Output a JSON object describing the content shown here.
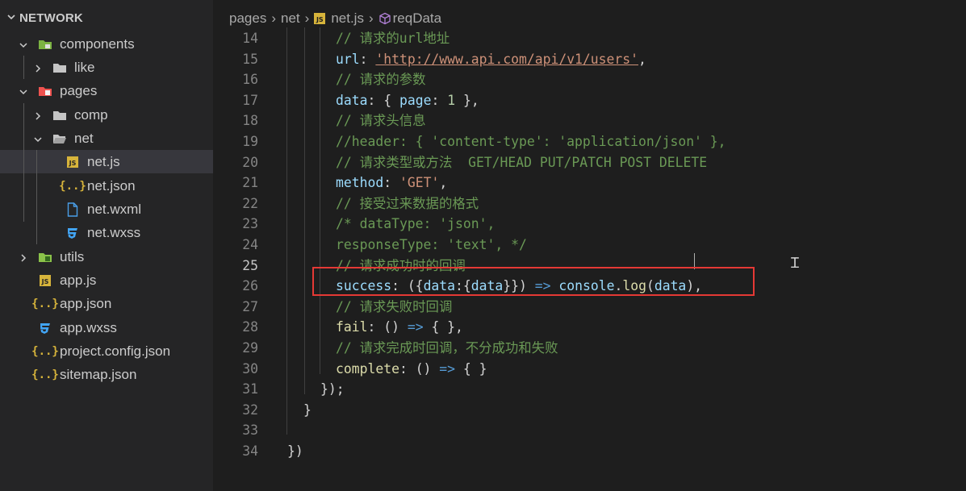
{
  "explorer": {
    "section_title": "NETWORK",
    "items": [
      {
        "label": "components",
        "icon": "folder-components-icon",
        "depth": 1,
        "expanded": true
      },
      {
        "label": "like",
        "icon": "folder-icon",
        "depth": 2,
        "expanded": false
      },
      {
        "label": "pages",
        "icon": "folder-pages-icon",
        "depth": 1,
        "expanded": true
      },
      {
        "label": "comp",
        "icon": "folder-icon",
        "depth": 2,
        "expanded": false
      },
      {
        "label": "net",
        "icon": "folder-open-icon",
        "depth": 2,
        "expanded": true
      },
      {
        "label": "net.js",
        "icon": "js-file-icon",
        "depth": 3,
        "selected": true
      },
      {
        "label": "net.json",
        "icon": "json-file-icon",
        "depth": 3
      },
      {
        "label": "net.wxml",
        "icon": "wxml-file-icon",
        "depth": 3
      },
      {
        "label": "net.wxss",
        "icon": "css-file-icon",
        "depth": 3
      },
      {
        "label": "utils",
        "icon": "folder-utils-icon",
        "depth": 1,
        "expanded": false
      },
      {
        "label": "app.js",
        "icon": "js-file-icon",
        "depth": 1
      },
      {
        "label": "app.json",
        "icon": "json-file-icon",
        "depth": 1
      },
      {
        "label": "app.wxss",
        "icon": "css-file-icon",
        "depth": 1
      },
      {
        "label": "project.config.json",
        "icon": "json-file-icon",
        "depth": 1
      },
      {
        "label": "sitemap.json",
        "icon": "json-file-icon",
        "depth": 1
      }
    ]
  },
  "breadcrumb": {
    "parts": [
      "pages",
      "net",
      "net.js",
      "reqData"
    ]
  },
  "editor": {
    "current_line": "25",
    "lines": [
      {
        "num": "14",
        "tokens": [
          [
            "c",
            "// 请求的url地址"
          ]
        ]
      },
      {
        "num": "15",
        "tokens": [
          [
            "k",
            "url"
          ],
          [
            "p",
            ": "
          ],
          [
            "s",
            "'http://www.api.com/api/v1/users'"
          ],
          [
            "p",
            ","
          ]
        ]
      },
      {
        "num": "16",
        "tokens": [
          [
            "c",
            "// 请求的参数"
          ]
        ]
      },
      {
        "num": "17",
        "tokens": [
          [
            "k",
            "data"
          ],
          [
            "p",
            ": { "
          ],
          [
            "k",
            "page"
          ],
          [
            "p",
            ": "
          ],
          [
            "n",
            "1"
          ],
          [
            "p",
            " },"
          ]
        ]
      },
      {
        "num": "18",
        "tokens": [
          [
            "c",
            "// 请求头信息"
          ]
        ]
      },
      {
        "num": "19",
        "tokens": [
          [
            "c",
            "//header: { 'content-type': 'application/json' },"
          ]
        ]
      },
      {
        "num": "20",
        "tokens": [
          [
            "c",
            "// 请求类型或方法  GET/HEAD PUT/PATCH POST DELETE"
          ]
        ]
      },
      {
        "num": "21",
        "tokens": [
          [
            "k",
            "method"
          ],
          [
            "p",
            ": "
          ],
          [
            "s",
            "'GET'"
          ],
          [
            "p",
            ","
          ]
        ]
      },
      {
        "num": "22",
        "tokens": [
          [
            "c",
            "// 接受过来数据的格式"
          ]
        ]
      },
      {
        "num": "23",
        "tokens": [
          [
            "c",
            "/* dataType: 'json',"
          ]
        ]
      },
      {
        "num": "24",
        "tokens": [
          [
            "c",
            "responseType: 'text', */"
          ]
        ]
      },
      {
        "num": "25",
        "tokens": [
          [
            "c",
            "// 请求成功时的回调"
          ]
        ]
      },
      {
        "num": "26",
        "tokens": [
          [
            "k",
            "success"
          ],
          [
            "p",
            ": ({"
          ],
          [
            "k",
            "data"
          ],
          [
            "p",
            ":{"
          ],
          [
            "k",
            "data"
          ],
          [
            "p",
            "}}) "
          ],
          [
            "o",
            "=>"
          ],
          [
            "p",
            " "
          ],
          [
            "k",
            "console"
          ],
          [
            "p",
            "."
          ],
          [
            "f",
            "log"
          ],
          [
            "p",
            "("
          ],
          [
            "k",
            "data"
          ],
          [
            "p",
            "),"
          ]
        ]
      },
      {
        "num": "27",
        "tokens": [
          [
            "c",
            "// 请求失败时回调"
          ]
        ]
      },
      {
        "num": "28",
        "tokens": [
          [
            "f",
            "fail"
          ],
          [
            "p",
            ": () "
          ],
          [
            "o",
            "=>"
          ],
          [
            "p",
            " { },"
          ]
        ]
      },
      {
        "num": "29",
        "tokens": [
          [
            "c",
            "// 请求完成时回调，不分成功和失败"
          ]
        ]
      },
      {
        "num": "30",
        "tokens": [
          [
            "f",
            "complete"
          ],
          [
            "p",
            ": () "
          ],
          [
            "o",
            "=>"
          ],
          [
            "p",
            " { }"
          ]
        ]
      },
      {
        "num": "31",
        "tokens": [
          [
            "p",
            "});"
          ]
        ]
      },
      {
        "num": "32",
        "tokens": [
          [
            "p",
            "}"
          ]
        ]
      },
      {
        "num": "33",
        "tokens": []
      },
      {
        "num": "34",
        "tokens": [
          [
            "p",
            "})"
          ]
        ]
      }
    ]
  },
  "colors": {
    "highlight_box": "#e53935",
    "sidebar_bg": "#252526",
    "editor_bg": "#1e1e1e"
  }
}
